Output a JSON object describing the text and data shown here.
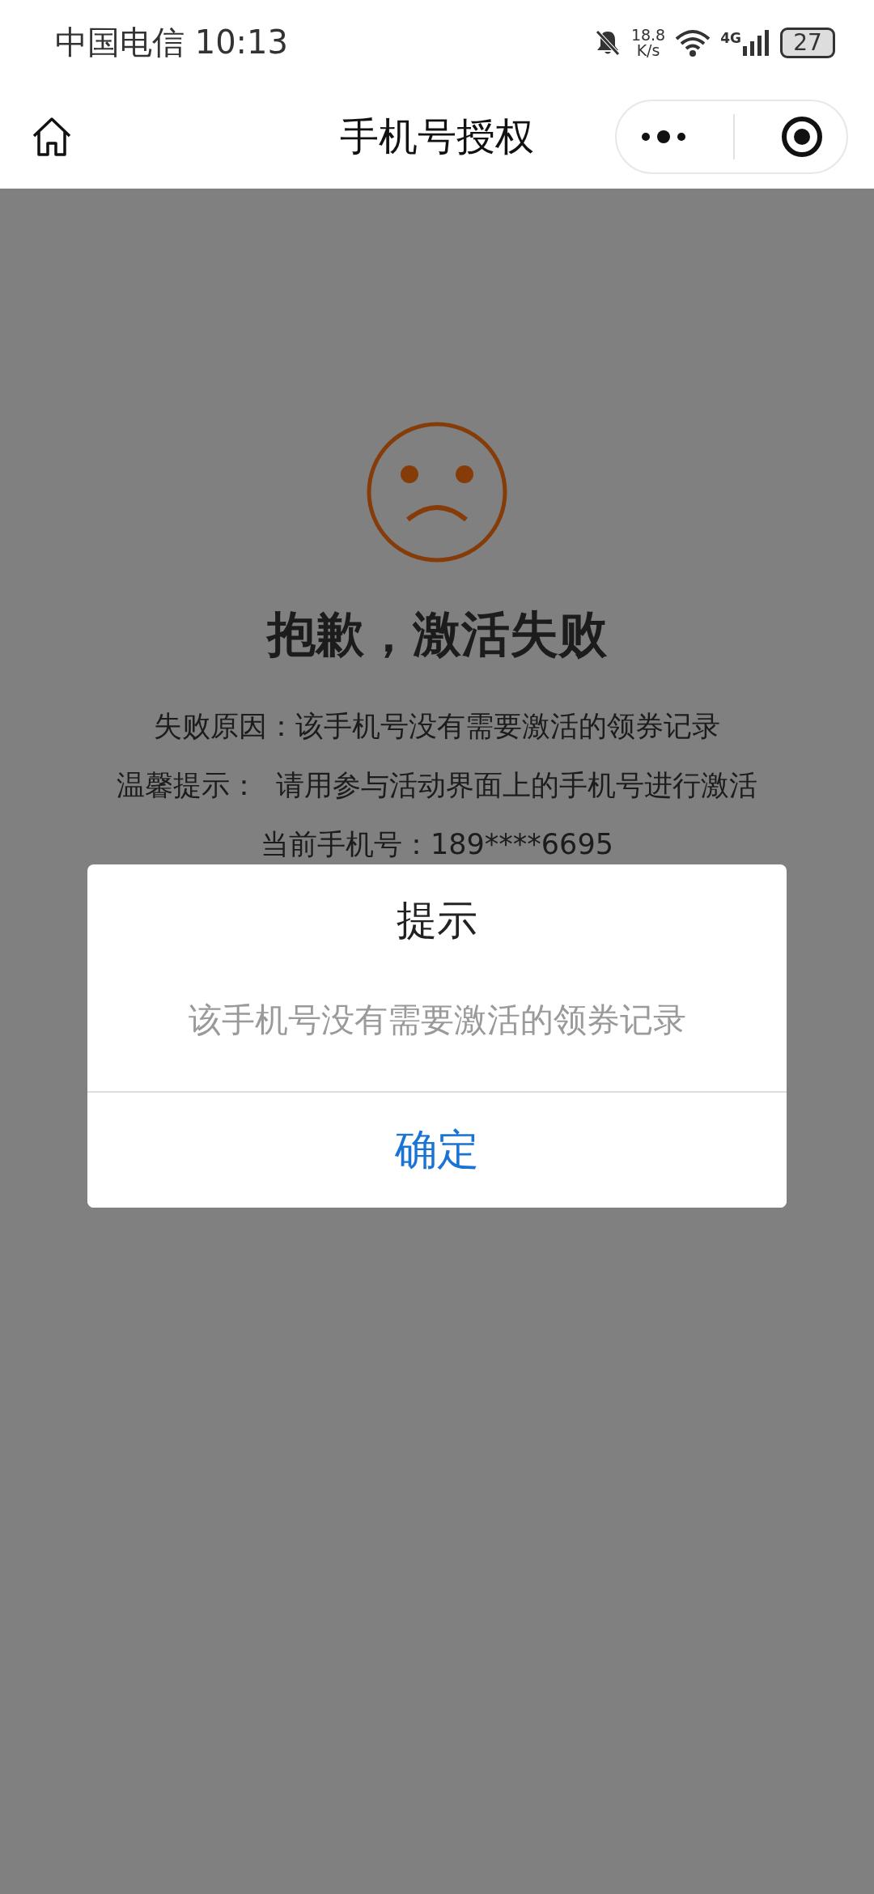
{
  "status_bar": {
    "carrier_time": "中国电信 10:13",
    "speed_value": "18.8",
    "speed_unit": "K/s",
    "network": "4G",
    "battery": "27"
  },
  "nav": {
    "title": "手机号授权"
  },
  "result": {
    "title": "抱歉，激活失败",
    "lines": [
      "失败原因：该手机号没有需要激活的领券记录",
      "温馨提示：  请用参与活动界面上的手机号进行激活",
      "当前手机号：189****6695"
    ]
  },
  "dialog": {
    "title": "提示",
    "message": "该手机号没有需要激活的领券记录",
    "buttons": [
      "确定"
    ]
  }
}
